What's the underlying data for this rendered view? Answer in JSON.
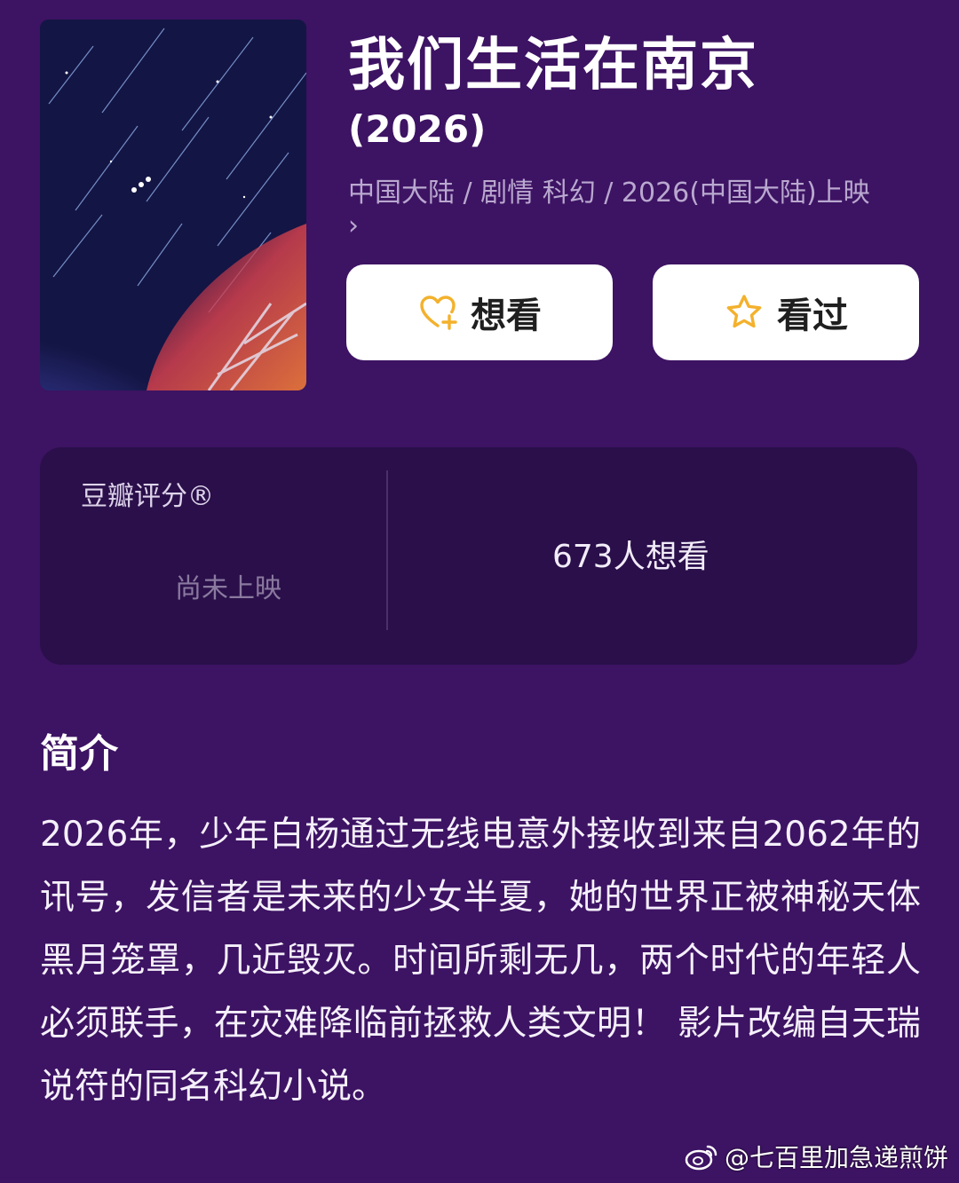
{
  "movie": {
    "title": "我们生活在南京",
    "year": "(2026)",
    "meta": "中国大陆 / 剧情 科幻 / 2026(中国大陆)上映",
    "meta_arrow": "›"
  },
  "actions": {
    "want_label": "想看",
    "seen_label": "看过",
    "icon_color": "#f3b12c"
  },
  "rating": {
    "label": "豆瓣评分®",
    "status": "尚未上映",
    "want_count": "673人想看"
  },
  "intro": {
    "title": "简介",
    "text": "2026年，少年白杨通过无线电意外接收到来自2062年的讯号，发信者是未来的少女半夏，她的世界正被神秘天体黑月笼罩，几近毁灭。时间所剩无几，两个时代的年轻人必须联手，在灾难降临前拯救人类文明！ 影片改编自天瑞说符的同名科幻小说。"
  },
  "watermark": {
    "text": "@七百里加急递煎饼"
  },
  "colors": {
    "background": "#3d1363",
    "panel": "#2a0f4a",
    "meta_text": "#b9a8cf"
  }
}
